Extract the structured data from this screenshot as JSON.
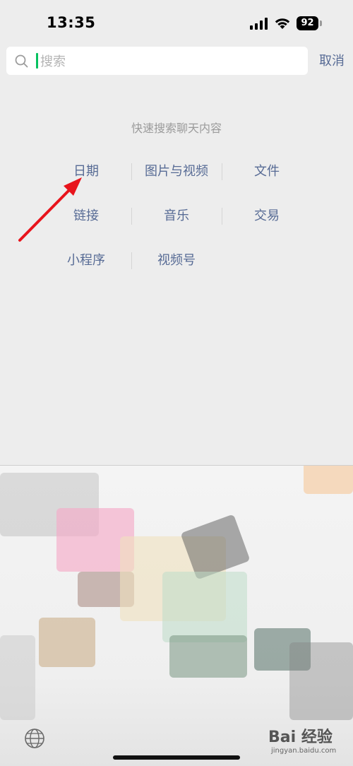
{
  "status_bar": {
    "time": "13:35",
    "battery": "92"
  },
  "search": {
    "placeholder": "搜索",
    "value": "",
    "cancel_label": "取消"
  },
  "quick_search": {
    "title": "快速搜索聊天内容",
    "categories": [
      {
        "label": "日期"
      },
      {
        "label": "图片与视频"
      },
      {
        "label": "文件"
      },
      {
        "label": "链接"
      },
      {
        "label": "音乐"
      },
      {
        "label": "交易"
      },
      {
        "label": "小程序"
      },
      {
        "label": "视频号"
      }
    ]
  },
  "annotation": {
    "color": "#e8141c",
    "target": "日期"
  },
  "colors": {
    "background": "#ededed",
    "link": "#576b95",
    "caret": "#07c160"
  },
  "watermark": {
    "brand": "Bai 经验",
    "url": "jingyan.baidu.com"
  }
}
